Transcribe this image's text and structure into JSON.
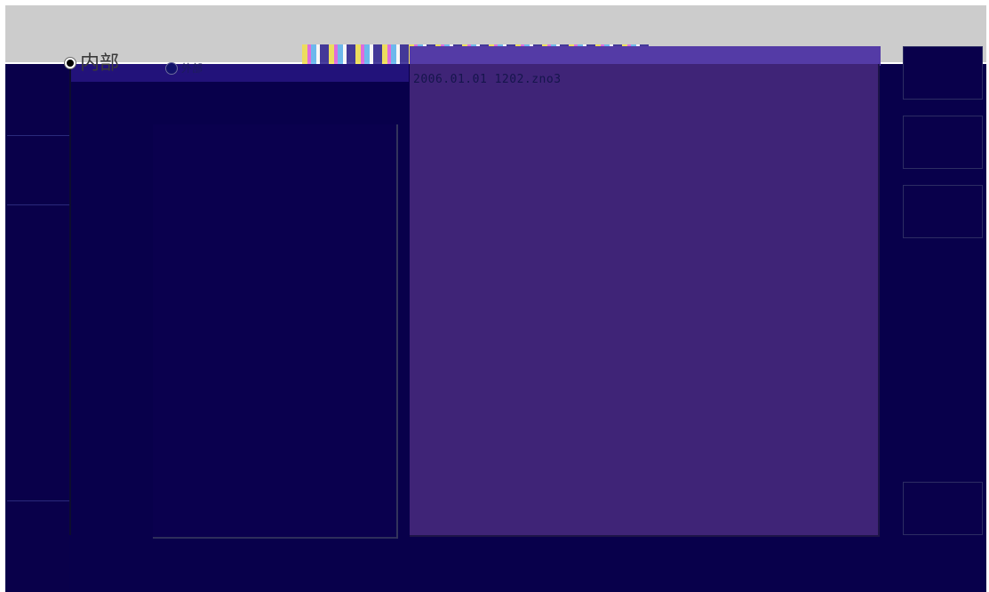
{
  "location_options": [
    {
      "label": "内部",
      "checked": true
    },
    {
      "label": "外部",
      "checked": false
    }
  ],
  "file_list": {
    "items": [
      "2006.01.01 1202.zno3"
    ]
  },
  "colors": {
    "screen_bg": "#08004b",
    "file_panel_bg": "#3f2477",
    "top_bar": "#cccccc"
  },
  "icons": {
    "radio_checked": "radio-checked-icon",
    "radio_unchecked": "radio-unchecked-icon"
  }
}
